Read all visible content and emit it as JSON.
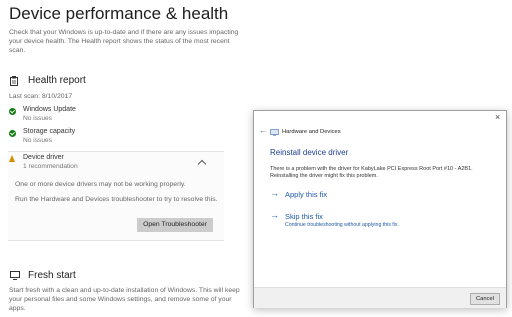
{
  "page": {
    "title": "Device performance & health",
    "description": "Check that your Windows is up-to-date and if there are any issues impacting your device health. The Health report shows the status of the most recent scan."
  },
  "health_report": {
    "heading": "Health report",
    "last_scan": "Last scan: 8/10/2017",
    "items": [
      {
        "title": "Windows Update",
        "status": "No issues"
      },
      {
        "title": "Storage capacity",
        "status": "No issues"
      }
    ],
    "device_driver": {
      "title": "Device driver",
      "status": "1 recommendation",
      "message": "One or more device drivers may not be working properly.",
      "instruction": "Run the Hardware and Devices troubleshooter to try to resolve this.",
      "button": "Open Troubleshooter"
    }
  },
  "fresh_start": {
    "heading": "Fresh start",
    "description": "Start fresh with a clean and up-to-date installation of Windows. This will keep your personal files and some Windows settings, and remove some of your apps."
  },
  "dialog": {
    "window_title": "Hardware and Devices",
    "heading": "Reinstall device driver",
    "message": "There is a problem with the driver for KabyLake PCI Express Root Port #10 - A2B1. Reinstalling the driver might fix this problem.",
    "apply_label": "Apply this fix",
    "skip_label": "Skip this fix",
    "skip_sub": "Continue troubleshooting without applying this fix.",
    "cancel_label": "Cancel"
  },
  "colors": {
    "ok": "#0f7b0f",
    "warning": "#d48c00",
    "link": "#1e5aa8"
  }
}
